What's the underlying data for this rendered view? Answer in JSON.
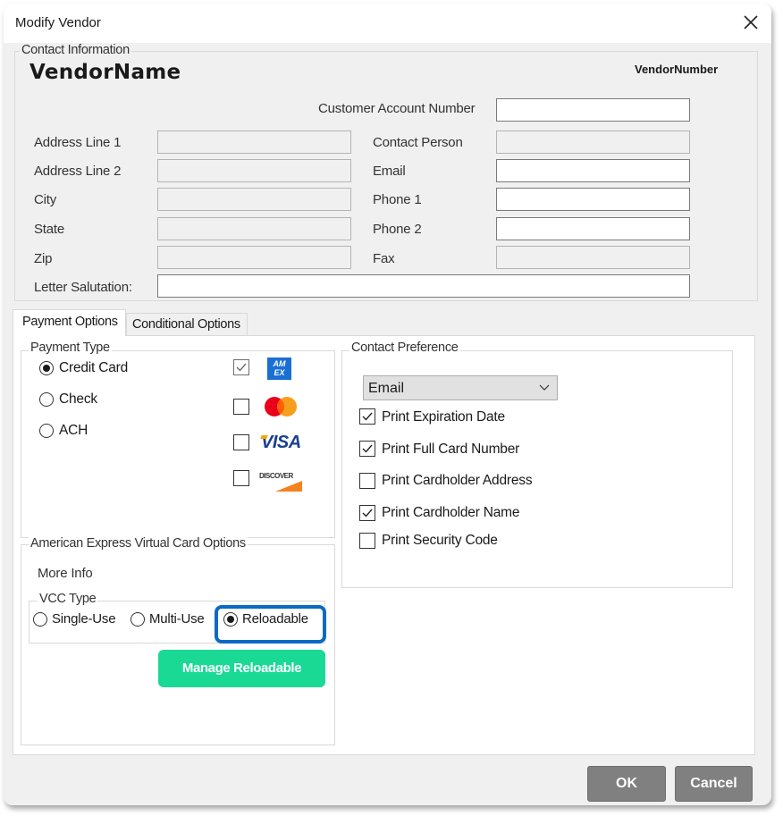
{
  "window": {
    "title": "Modify Vendor",
    "close_icon": "close-icon"
  },
  "contact_info": {
    "group_label": "Contact Information",
    "vendor_name": "VendorName",
    "vendor_number": "VendorNumber",
    "customer_account_number": {
      "label": "Customer Account Number",
      "value": ""
    },
    "left_fields": [
      {
        "label": "Address Line 1",
        "value": "",
        "enabled": false
      },
      {
        "label": "Address Line 2",
        "value": "",
        "enabled": false
      },
      {
        "label": "City",
        "value": "",
        "enabled": false
      },
      {
        "label": "State",
        "value": "",
        "enabled": false
      },
      {
        "label": "Zip",
        "value": "",
        "enabled": false
      }
    ],
    "right_fields": [
      {
        "label": "Contact Person",
        "value": "",
        "enabled": false
      },
      {
        "label": "Email",
        "value": "",
        "enabled": true
      },
      {
        "label": "Phone 1",
        "value": "",
        "enabled": true
      },
      {
        "label": "Phone 2",
        "value": "",
        "enabled": true
      },
      {
        "label": "Fax",
        "value": "",
        "enabled": false
      }
    ],
    "letter_salutation": {
      "label": "Letter Salutation:",
      "value": ""
    }
  },
  "tabs": [
    {
      "label": "Payment Options",
      "active": true
    },
    {
      "label": "Conditional Options",
      "active": false
    }
  ],
  "payment_type": {
    "group_label": "Payment Type",
    "options": [
      {
        "label": "Credit Card",
        "selected": true
      },
      {
        "label": "Check",
        "selected": false
      },
      {
        "label": "ACH",
        "selected": false
      }
    ],
    "cards": [
      {
        "name": "American Express",
        "icon": "amex-logo-icon",
        "checked": true,
        "enabled": false
      },
      {
        "name": "Mastercard",
        "icon": "mastercard-logo-icon",
        "checked": false,
        "enabled": true
      },
      {
        "name": "Visa",
        "icon": "visa-logo-icon",
        "logo_text": "VISA",
        "checked": false,
        "enabled": true
      },
      {
        "name": "Discover",
        "icon": "discover-logo-icon",
        "logo_text": "DISCOVER",
        "checked": false,
        "enabled": true
      }
    ],
    "amex_logo_text": [
      "AM",
      "EX"
    ]
  },
  "amex_vcc": {
    "group_label": "American Express Virtual Card Options",
    "more_info": "More Info",
    "vcc_type_label": "VCC Type",
    "vcc_options": [
      {
        "label": "Single-Use",
        "selected": false
      },
      {
        "label": "Multi-Use",
        "selected": false
      },
      {
        "label": "Reloadable",
        "selected": true
      }
    ],
    "manage_button": "Manage Reloadable",
    "highlight_color": "#0a6ac4",
    "button_color": "#19d995"
  },
  "contact_preference": {
    "group_label": "Contact Preference",
    "selected": "Email",
    "options": [
      {
        "label": "Print Expiration Date",
        "checked": true
      },
      {
        "label": "Print Full Card Number",
        "checked": true
      },
      {
        "label": "Print Cardholder Address",
        "checked": false
      },
      {
        "label": "Print Cardholder Name",
        "checked": true
      },
      {
        "label": "Print Security Code",
        "checked": false
      }
    ]
  },
  "footer": {
    "ok": "OK",
    "cancel": "Cancel"
  }
}
